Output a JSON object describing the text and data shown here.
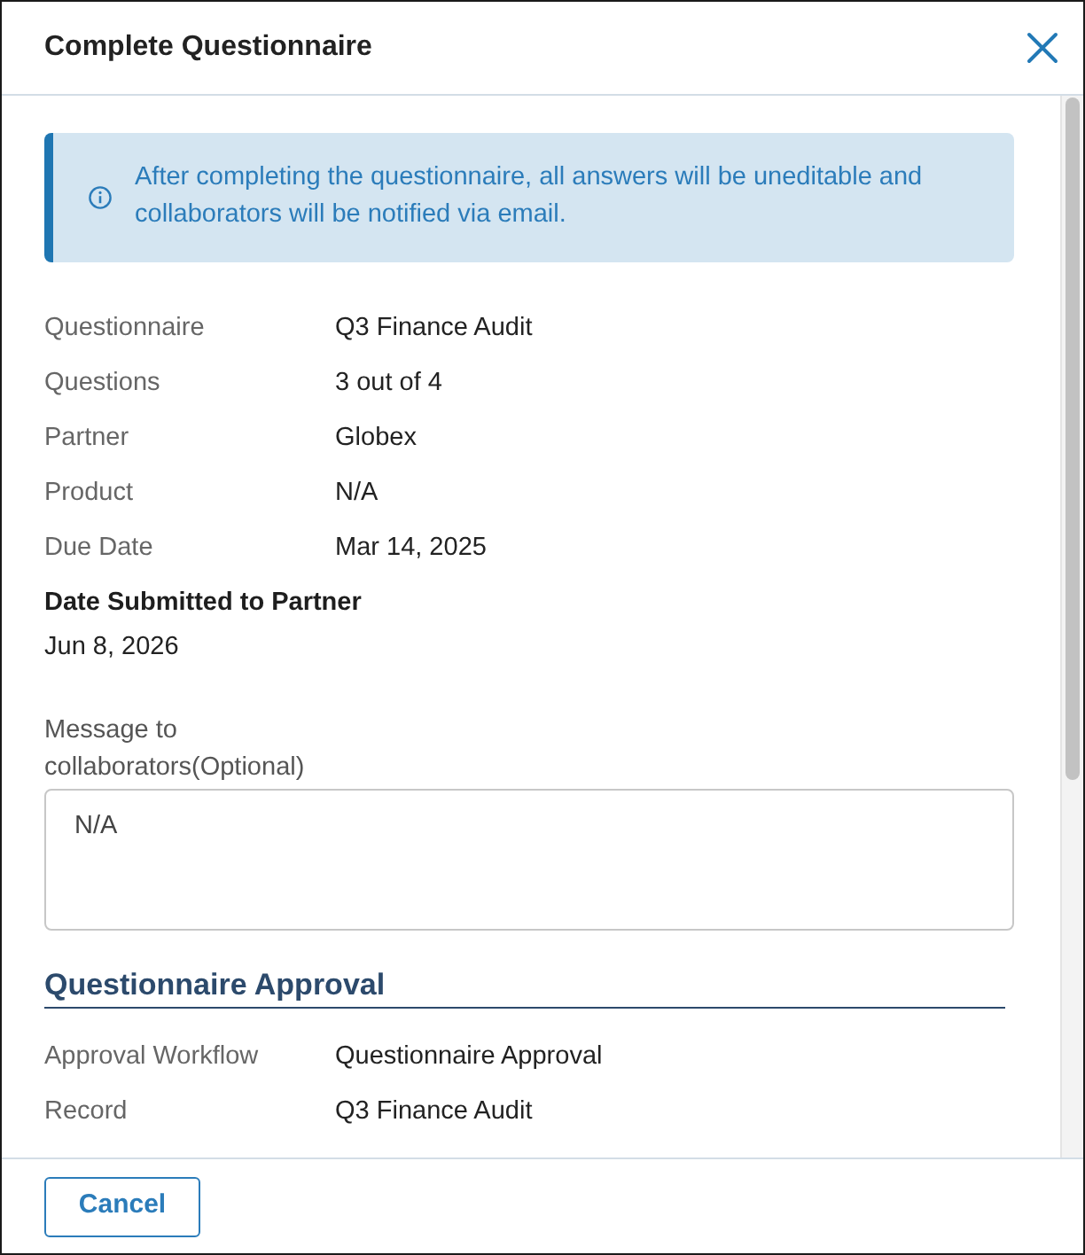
{
  "dialog": {
    "title": "Complete Questionnaire"
  },
  "alert": {
    "text": "After completing the questionnaire, all answers will be uneditable and collaborators will be notified via email."
  },
  "details": [
    {
      "label": "Questionnaire",
      "value": "Q3 Finance Audit"
    },
    {
      "label": "Questions",
      "value": "3 out of 4"
    },
    {
      "label": "Partner",
      "value": "Globex"
    },
    {
      "label": "Product",
      "value": "N/A"
    },
    {
      "label": "Due Date",
      "value": "Mar 14, 2025"
    }
  ],
  "submitted": {
    "label": "Date Submitted to Partner",
    "value": "Jun 8, 2026"
  },
  "message": {
    "label": "Message to collaborators(Optional)",
    "value": "N/A"
  },
  "approval": {
    "title": "Questionnaire Approval",
    "rows": [
      {
        "label": "Approval Workflow",
        "value": "Questionnaire Approval"
      },
      {
        "label": "Record",
        "value": "Q3 Finance Audit"
      }
    ]
  },
  "footer": {
    "buttons": [
      {
        "label": "Cancel"
      }
    ]
  }
}
